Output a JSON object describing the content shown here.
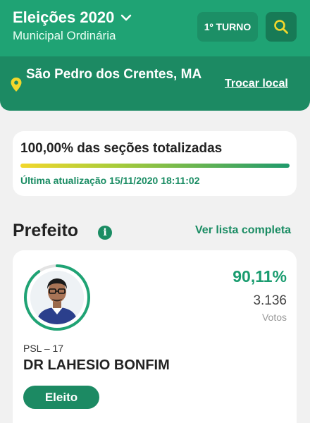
{
  "header": {
    "title": "Eleições 2020",
    "subtitle": "Municipal Ordinária",
    "turno_label": "1º TURNO",
    "location": "São Pedro dos Crentes, MA",
    "change_location": "Trocar local"
  },
  "progress": {
    "title": "100,00% das seções totalizadas",
    "percent": 100,
    "updated": "Última atualização 15/11/2020 18:11:02"
  },
  "section": {
    "title": "Prefeito",
    "see_all": "Ver lista completa"
  },
  "candidate": {
    "percent": "90,11%",
    "percent_value": 90.11,
    "votes": "3.136",
    "votes_label": "Votos",
    "party": "PSL – 17",
    "name": "DR LAHESIO BONFIM",
    "status": "Eleito"
  },
  "colors": {
    "brand": "#1fa374",
    "brand_dark": "#1c8a63",
    "accent": "#f2d72c"
  },
  "icons": [
    "chevron-down-icon",
    "search-icon",
    "location-pin-icon",
    "info-icon",
    "avatar"
  ]
}
